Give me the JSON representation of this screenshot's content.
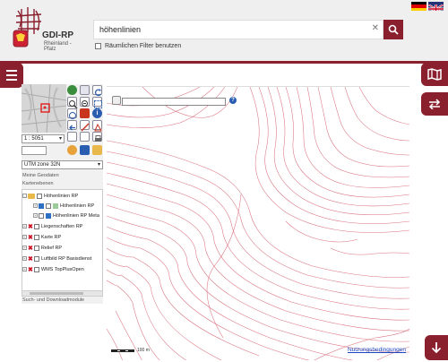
{
  "header": {
    "logo_title": "GDI-RP",
    "logo_sub": "Rheinland - Pfalz",
    "search_value": "höhenlinien",
    "filter_label": "Räumlichen Filter benutzen"
  },
  "panel": {
    "scale_value": "1 : 5051",
    "crs_value": "UTM zone 32N",
    "my_geodata_label": "Meine Geodaten",
    "map_levels_label": "Kartenebenen",
    "layers": [
      {
        "label": "Höhenlinien RP"
      },
      {
        "label": "Höhenlinien RP"
      },
      {
        "label": "Höhenlinien RP Meta"
      },
      {
        "label": "Liegenschaften RP"
      },
      {
        "label": "Karte RP"
      },
      {
        "label": "Relief RP"
      },
      {
        "label": "Luftbild RP Basisdienst"
      },
      {
        "label": "WMS TopPlusOpen"
      }
    ],
    "downloads_label": "Such- und Downloadmodule"
  },
  "map": {
    "scale_label": "100 m",
    "terms_label": "Nutzungsbedingungen"
  },
  "colors": {
    "brand": "#8a1f2e",
    "contour": "#d25a6a"
  }
}
